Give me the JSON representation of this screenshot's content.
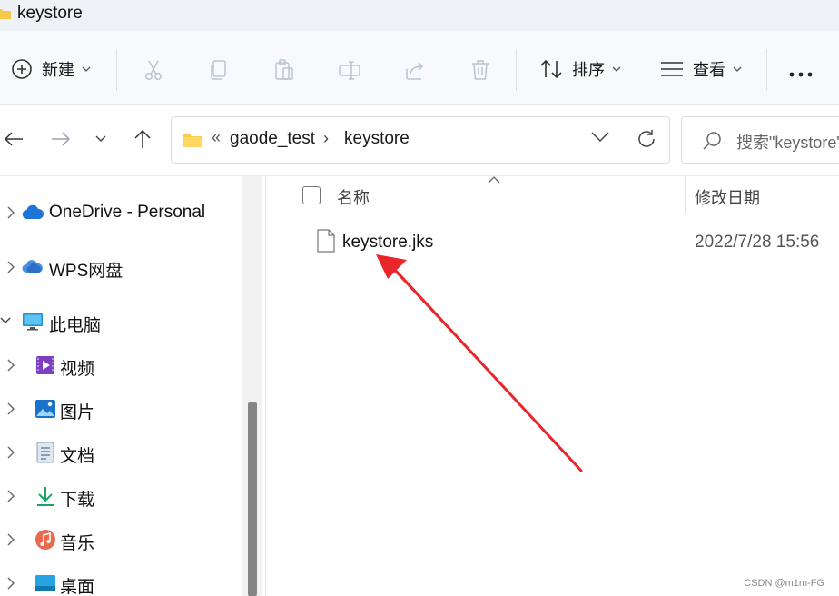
{
  "window": {
    "title": "keystore"
  },
  "toolbar": {
    "new_label": "新建",
    "sort_label": "排序",
    "view_label": "查看",
    "more_label": "•••"
  },
  "address": {
    "overflow": "«",
    "segments": [
      "gaode_test",
      "keystore"
    ],
    "separator": "›"
  },
  "search": {
    "placeholder": "搜索\"keystore\""
  },
  "sidebar": {
    "items": [
      {
        "label": "OneDrive - Personal",
        "icon": "cloud-icon"
      },
      {
        "label": "WPS网盘",
        "icon": "wps-cloud-icon"
      },
      {
        "label": "此电脑",
        "icon": "computer-icon"
      },
      {
        "label": "视频",
        "icon": "video-icon"
      },
      {
        "label": "图片",
        "icon": "picture-icon"
      },
      {
        "label": "文档",
        "icon": "document-icon"
      },
      {
        "label": "下载",
        "icon": "download-icon"
      },
      {
        "label": "音乐",
        "icon": "music-icon"
      },
      {
        "label": "桌面",
        "icon": "desktop-icon"
      }
    ]
  },
  "file_list": {
    "columns": {
      "name": "名称",
      "date": "修改日期"
    },
    "rows": [
      {
        "name": "keystore.jks",
        "date": "2022/7/28 15:56"
      }
    ]
  },
  "watermark": "CSDN @m1m-FG",
  "colors": {
    "accent": "#0067c0",
    "arrow": "#e8262b",
    "folder": "#f7c948"
  }
}
